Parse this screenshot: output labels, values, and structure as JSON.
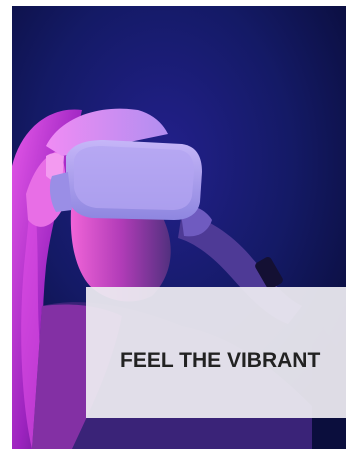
{
  "hero": {
    "image_icon": "vr-headset-woman-photo",
    "caption": "FEEL THE VIBRANT"
  },
  "colors": {
    "background_dark": "#0d1451",
    "neon_magenta": "#d21cd0",
    "headset_lavender": "#b7a7ee",
    "caption_panel": "#eceaf0",
    "caption_text": "#222222"
  }
}
